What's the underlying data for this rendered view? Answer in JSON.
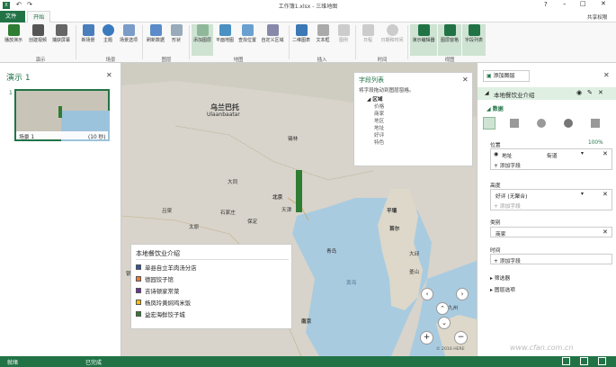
{
  "window": {
    "title": "工作簿1.xlsx - 三维地图",
    "share": "共享权限"
  },
  "tabs": [
    "文件",
    "开始"
  ],
  "ribbon": {
    "buttons": [
      "播放演示",
      "创建视频",
      "捕获屏幕",
      "新场景",
      "主题",
      "场景选项",
      "刷新数据",
      "形状",
      "添加图层",
      "平面地图",
      "查找位置",
      "自定义区域",
      "二维图表",
      "文本框",
      "图例",
      "日程",
      "日期和时间",
      "演示编辑器",
      "图层窗格",
      "字段列表"
    ],
    "groups": [
      "演示",
      "场景",
      "图层",
      "地图",
      "插入",
      "时间",
      "视图"
    ]
  },
  "tour": {
    "title": "演示 1",
    "scene_number": "1",
    "scene_label": "场景 1",
    "scene_time": "(10 秒)"
  },
  "map": {
    "cities": [
      "乌兰巴托",
      "Ulaanbaatar",
      "北京",
      "天津",
      "石家庄",
      "太原",
      "济南",
      "郑州",
      "南京",
      "平壤",
      "首尔",
      "大邱",
      "釜山",
      "九州",
      "锡林",
      "大同",
      "保定",
      "吕梁",
      "青岛",
      "银川",
      "黄海"
    ],
    "legend": {
      "title": "本地餐饮业介绍",
      "items": [
        {
          "label": "单县自立羊肉汤分店",
          "color": "#2f5597"
        },
        {
          "label": "德园饺子馆",
          "color": "#ed7d31"
        },
        {
          "label": "吉诗顿家常菜",
          "color": "#7030a0"
        },
        {
          "label": "杨凤玲黄焖鸡米饭",
          "color": "#ffc000"
        },
        {
          "label": "益宏海鲜饺子城",
          "color": "#2e7d32"
        }
      ]
    },
    "field_list": {
      "title": "字段列表",
      "hint": "将字段拖动到图层窗格。",
      "table": "区域",
      "fields": [
        "价格",
        "商家",
        "地区",
        "地址",
        "好评",
        "特色"
      ]
    },
    "copyright": "© 2016 HERE"
  },
  "layer_pane": {
    "add_layer": "添加图层",
    "layer_name": "本地餐饮业介绍",
    "data_label": "数据",
    "location_label": "位置",
    "location_pct": "100%",
    "location_field": "地址",
    "location_type": "街道",
    "add_field_1": "添加字段",
    "height_label": "高度",
    "height_field": "好评 (无聚合)",
    "add_field_2": "添加字段",
    "category_label": "类别",
    "category_field": "商家",
    "time_label": "时间",
    "add_field_3": "添加字段",
    "filters": "筛选器",
    "layer_options": "图层选项"
  },
  "status": {
    "left": "就绪",
    "center": "已完成"
  },
  "watermark": "www.cfan.com.cn"
}
